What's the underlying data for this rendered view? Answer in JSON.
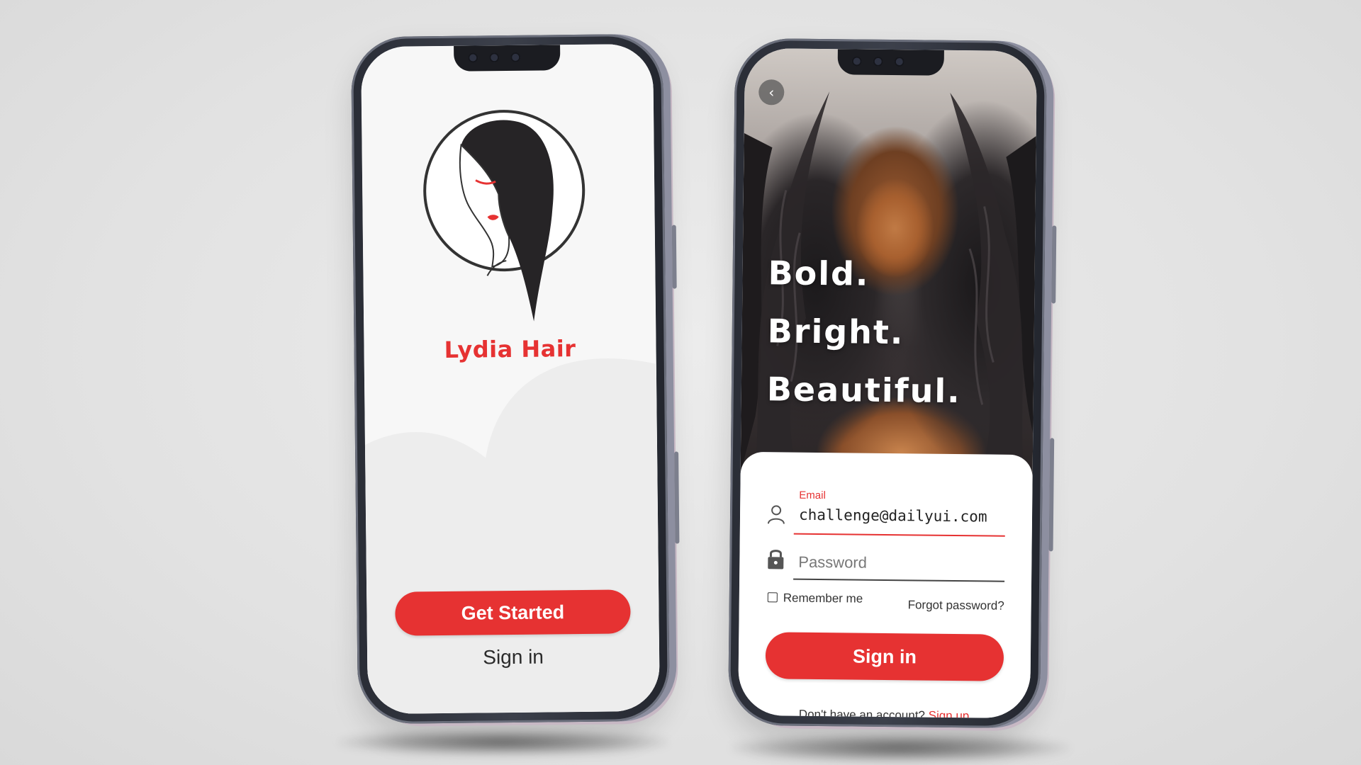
{
  "theme": {
    "accent": "#e63232",
    "frame": "#2f323b",
    "background": "#e3e3e3"
  },
  "welcome_screen": {
    "brand_name": "Lydia Hair",
    "logo_icon": "woman-silhouette-logo",
    "get_started_label": "Get Started",
    "sign_in_label": "Sign in"
  },
  "signin_screen": {
    "back_icon": "chevron-left-icon",
    "tagline": [
      "Bold.",
      "Bright.",
      "Beautiful."
    ],
    "email": {
      "label": "Email",
      "value": "challenge@dailyui.com",
      "icon": "user-icon"
    },
    "password": {
      "placeholder": "Password",
      "icon": "lock-icon"
    },
    "remember_me_label": "Remember me",
    "forgot_password_label": "Forgot password?",
    "sign_in_button_label": "Sign in",
    "no_account_text": "Don't have an account?",
    "sign_up_label": "Sign up"
  }
}
